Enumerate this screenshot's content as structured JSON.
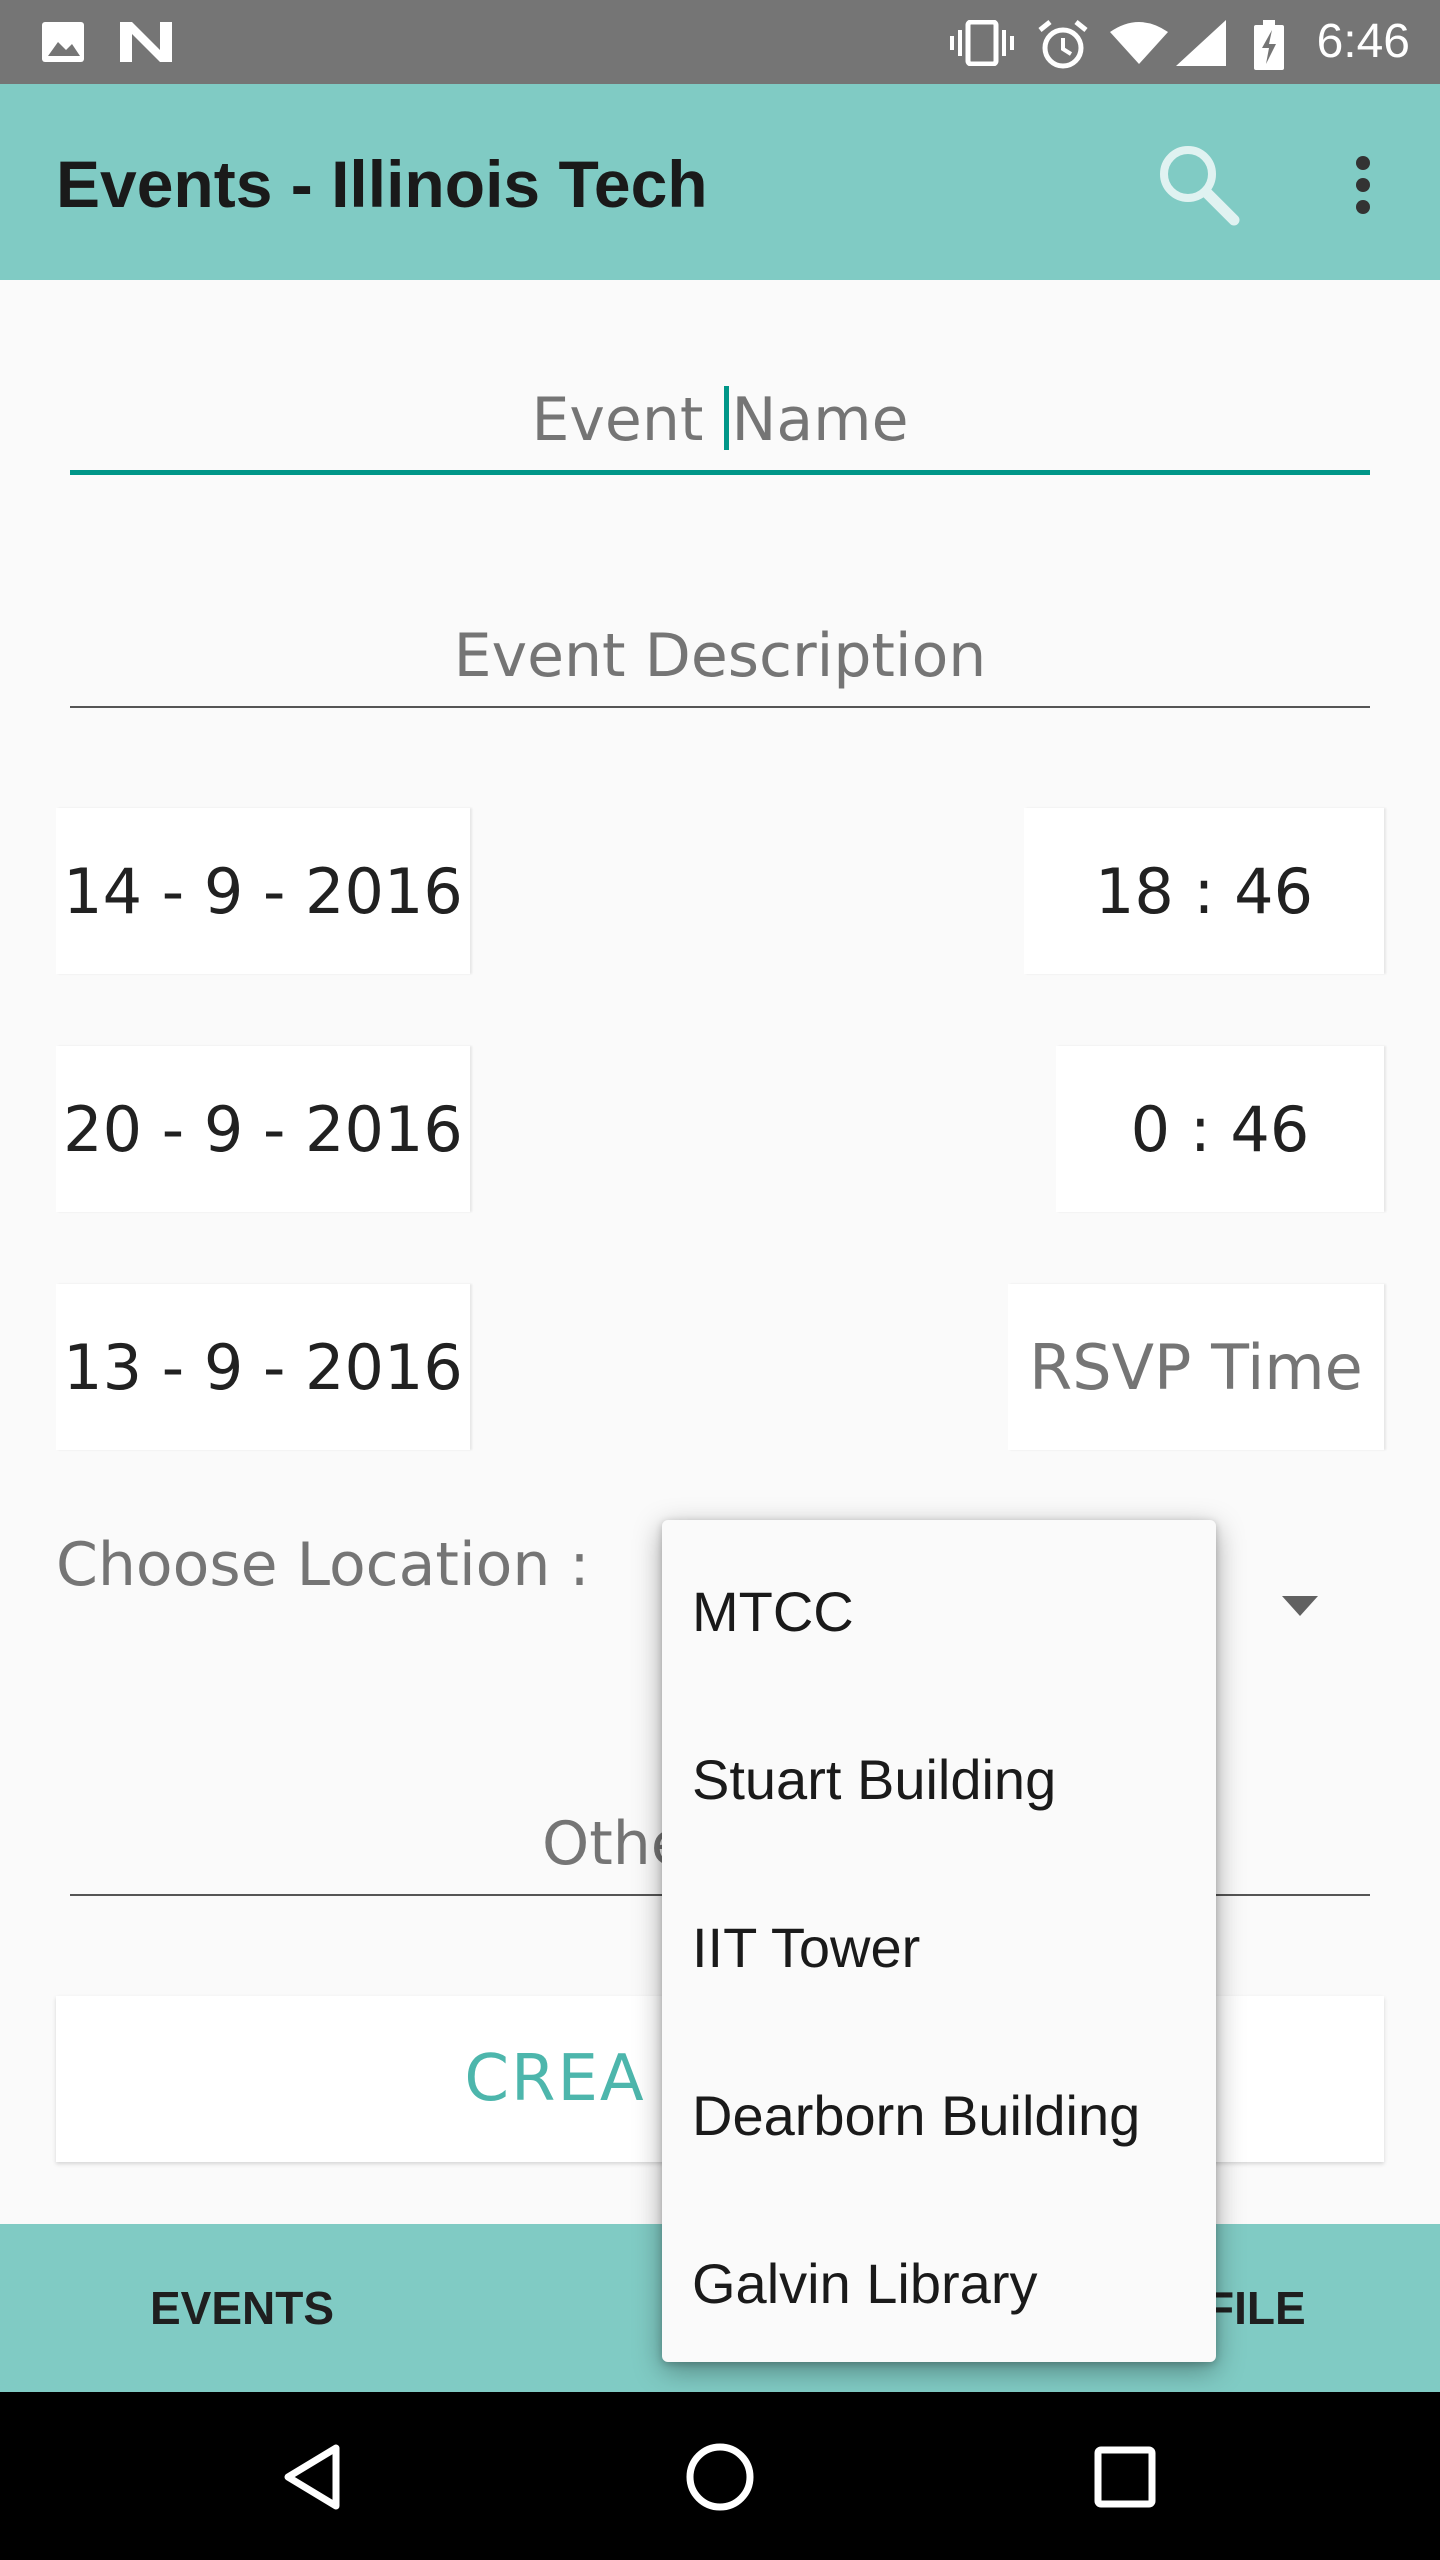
{
  "status_bar": {
    "time": "6:46"
  },
  "app_bar": {
    "title": "Events - Illinois Tech"
  },
  "form": {
    "event_name_placeholder": "Event Name",
    "event_name_placeholder_before_cursor": "Event ",
    "event_name_placeholder_after_cursor": "Name",
    "event_description_placeholder": "Event Description",
    "start_date": "14 - 9 - 2016",
    "start_time": "18 : 46",
    "end_date": "20 - 9 - 2016",
    "end_time": "0 : 46",
    "rsvp_date": "13 - 9 - 2016",
    "rsvp_time_placeholder": "RSVP Time",
    "location_label": "Choose Location :",
    "other_placeholder_visible": "Othe",
    "create_button_visible": "CREA"
  },
  "location_options": [
    "MTCC",
    "Stuart Building",
    "IIT Tower",
    "Dearborn Building",
    "Galvin Library"
  ],
  "bottom_tabs": {
    "events": "EVENTS",
    "profile_visible": "FILE"
  },
  "colors": {
    "status_bar": "#757575",
    "app_bar": "#80cbc4",
    "accent": "#009688",
    "button_text": "#4db6ac"
  },
  "icons": [
    "image-icon",
    "n-icon",
    "vibrate-icon",
    "alarm-icon",
    "wifi-icon",
    "signal-icon",
    "battery-icon",
    "search-icon",
    "more-vert-icon",
    "back-icon",
    "home-icon",
    "recents-icon"
  ]
}
